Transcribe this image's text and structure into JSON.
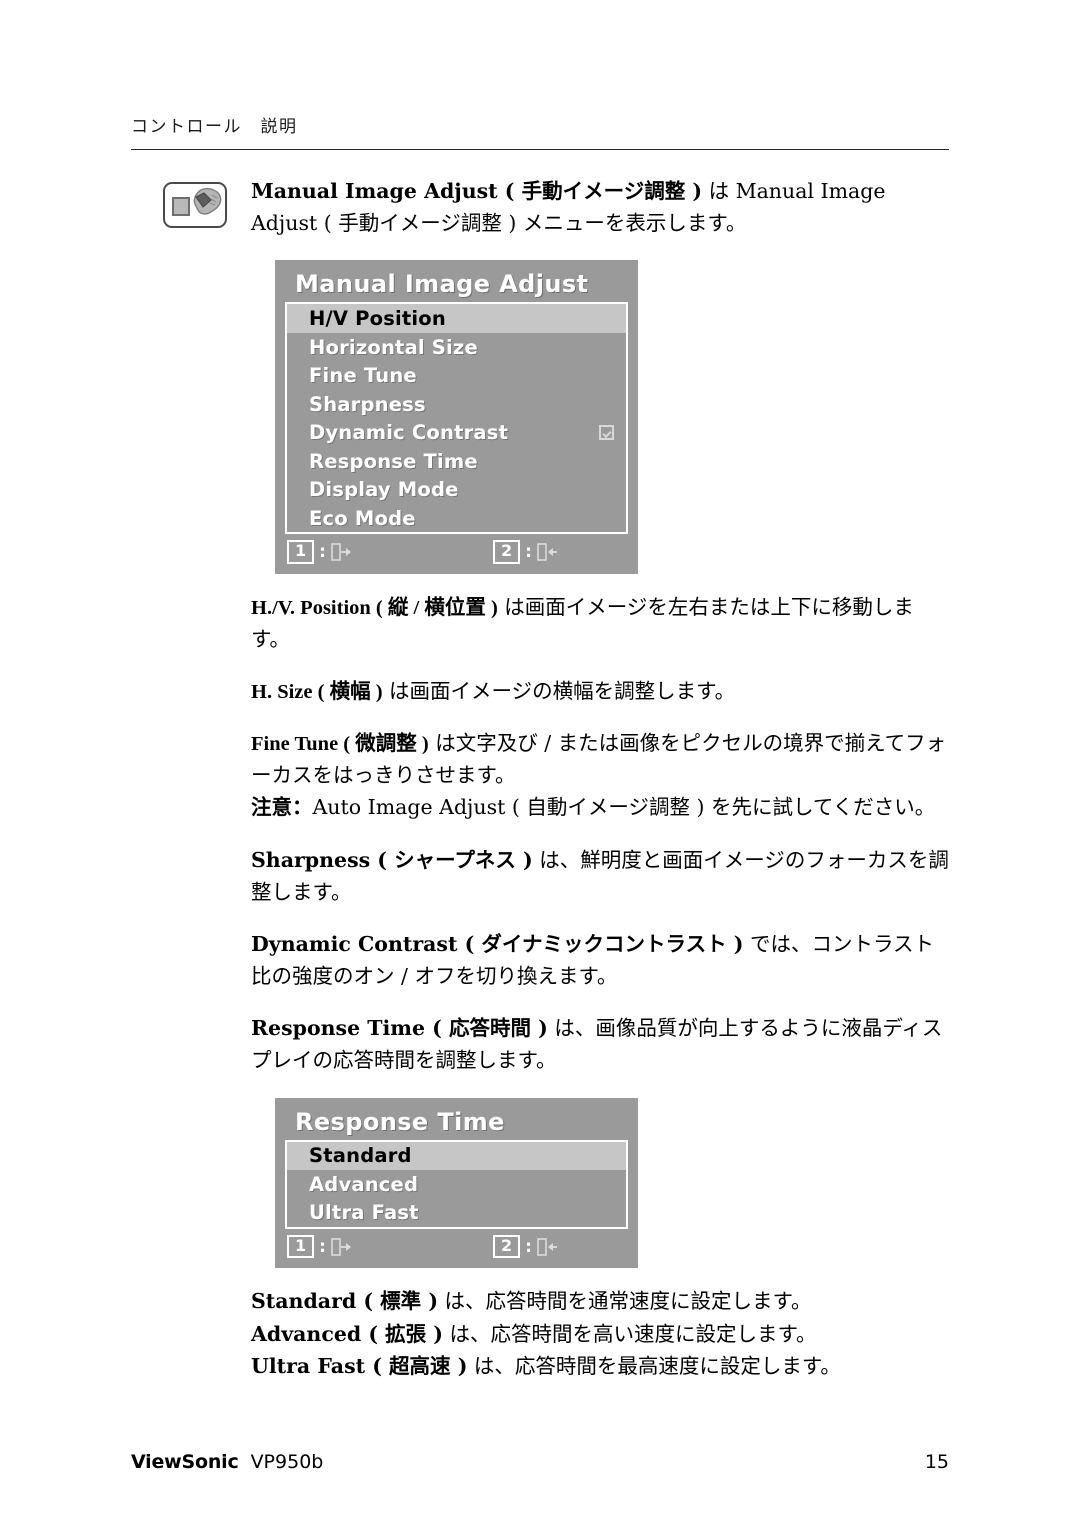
{
  "header": {
    "running_head": "コントロール　説明"
  },
  "intro": {
    "icon": "monitor-button-press-icon",
    "text": "Manual Image Adjust ( 手動イメージ調整 ) は Manual Image Adjust ( 手動イメージ調整 ) メニューを表示します。",
    "bold_prefix": "Manual Image Adjust ( 手動イメージ調整 )",
    "rest": " は Manual Image Adjust ( 手動イメージ調整 ) メニューを表示します。"
  },
  "osd_manual_image_adjust": {
    "title": "Manual Image Adjust",
    "items": [
      {
        "label": "H/V Position",
        "selected": true,
        "checkbox": false
      },
      {
        "label": "Horizontal Size",
        "selected": false,
        "checkbox": false
      },
      {
        "label": "Fine Tune",
        "selected": false,
        "checkbox": false
      },
      {
        "label": "Sharpness",
        "selected": false,
        "checkbox": false
      },
      {
        "label": "Dynamic Contrast",
        "selected": false,
        "checkbox": true
      },
      {
        "label": "Response Time",
        "selected": false,
        "checkbox": false
      },
      {
        "label": "Display Mode",
        "selected": false,
        "checkbox": false
      },
      {
        "label": "Eco Mode",
        "selected": false,
        "checkbox": false
      }
    ],
    "footer": {
      "key1": "1",
      "key1_sep": ":",
      "key1_icon": "exit-right-arrow-icon",
      "key2": "2",
      "key2_sep": ":",
      "key2_icon": "enter-left-arrow-icon"
    }
  },
  "paragraphs": {
    "hv_position": {
      "bold": "H./V. Position ( 縦 / 横位置 )",
      "rest": " は画面イメージを左右または上下に移動します。"
    },
    "h_size": {
      "bold": "H. Size ( 横幅 )",
      "rest": " は画面イメージの横幅を調整します。"
    },
    "fine_tune": {
      "bold": "Fine Tune ( 微調整 )",
      "rest": " は文字及び / または画像をピクセルの境界で揃えてフォーカスをはっきりさせます。",
      "note_bold": "注意：",
      "note_rest": "Auto Image Adjust ( 自動イメージ調整 ) を先に試してください。"
    },
    "sharpness": {
      "bold": "Sharpness ( シャープネス )",
      "rest": " は、鮮明度と画面イメージのフォーカスを調整します。"
    },
    "dynamic_contrast": {
      "bold": "Dynamic Contrast ( ダイナミックコントラスト )",
      "rest": " では、コントラスト比の強度のオン / オフを切り換えます。"
    },
    "response_time": {
      "bold": "Response Time ( 応答時間 )",
      "rest": " は、画像品質が向上するように液晶ディスプレイの応答時間を調整します。"
    }
  },
  "osd_response_time": {
    "title": "Response Time",
    "items": [
      {
        "label": "Standard",
        "selected": true
      },
      {
        "label": "Advanced",
        "selected": false
      },
      {
        "label": "Ultra Fast",
        "selected": false
      }
    ],
    "footer": {
      "key1": "1",
      "key1_sep": ":",
      "key1_icon": "exit-right-arrow-icon",
      "key2": "2",
      "key2_sep": ":",
      "key2_icon": "enter-left-arrow-icon"
    }
  },
  "response_time_descriptions": [
    {
      "bold": "Standard ( 標準 )",
      "rest": " は、応答時間を通常速度に設定します。"
    },
    {
      "bold": "Advanced ( 拡張 )",
      "rest": " は、応答時間を高い速度に設定します。"
    },
    {
      "bold": "Ultra Fast ( 超高速 )",
      "rest": " は、応答時間を最高速度に設定します。"
    }
  ],
  "footer": {
    "brand": "ViewSonic",
    "model": "VP950b",
    "page_number": "15"
  },
  "colors": {
    "osd_background": "#9a9a9a",
    "osd_selected_row": "#c6c6c6",
    "osd_text": "#ffffff",
    "osd_selected_text": "#000000",
    "body_text": "#000000"
  }
}
